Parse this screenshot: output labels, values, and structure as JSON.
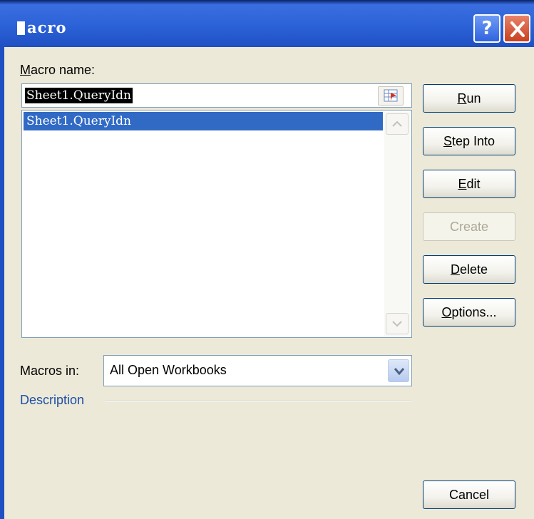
{
  "window": {
    "title": "acro",
    "help_label": "?"
  },
  "macro_name": {
    "label": "Macro name:",
    "value": "Sheet1.QueryIdn"
  },
  "macro_list": {
    "items": [
      "Sheet1.QueryIdn"
    ]
  },
  "buttons": {
    "run": "Run",
    "step_into": "Step Into",
    "edit": "Edit",
    "create": "Create",
    "delete": "Delete",
    "options": "Options...",
    "cancel": "Cancel"
  },
  "macros_in": {
    "label": "Macros in:",
    "value": "All Open Workbooks"
  },
  "description": {
    "label": "Description"
  },
  "colors": {
    "titlebar": "#2c62d8",
    "dialog_bg": "#ece9d8",
    "selection": "#316ac5",
    "description_text": "#1e4fa8"
  },
  "icons": {
    "title": "window-icon",
    "help": "help-icon",
    "close": "close-icon",
    "ref_edit": "ref-edit-icon",
    "scroll_up": "scroll-up-icon",
    "scroll_down": "scroll-down-icon",
    "dropdown": "chevron-down-icon"
  }
}
